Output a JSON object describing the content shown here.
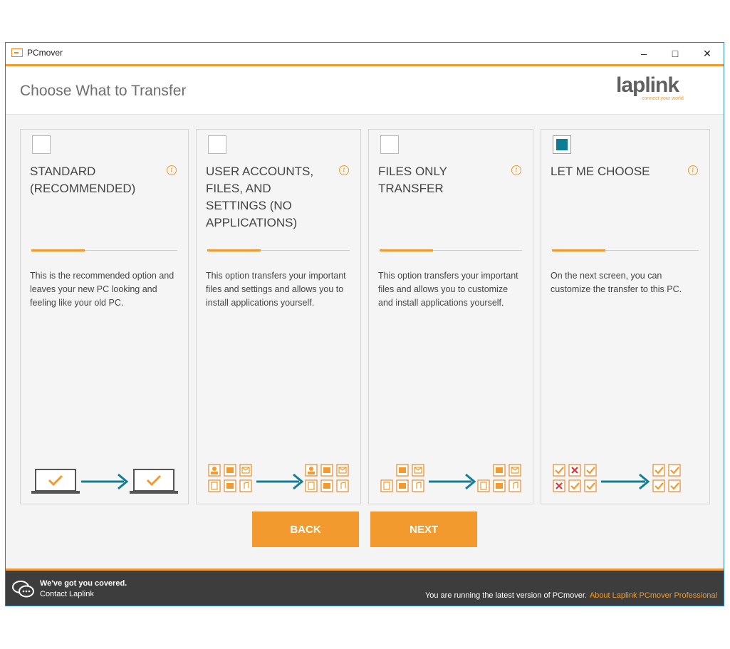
{
  "window": {
    "title": "PCmover",
    "minimize_glyph": "–",
    "maximize_glyph": "□",
    "close_glyph": "✕"
  },
  "header": {
    "title": "Choose What to Transfer",
    "logo_word": "laplink",
    "logo_tagline": "connect your world"
  },
  "cards": [
    {
      "title": "STANDARD (RECOMMENDED)",
      "checked": false,
      "info_glyph": "i",
      "description": "This is the recommended option and leaves your new PC looking and feeling like your old PC.",
      "illustration": "laptop-to-laptop"
    },
    {
      "title": "USER ACCOUNTS, FILES, AND SETTINGS (NO APPLICATIONS)",
      "checked": false,
      "info_glyph": "i",
      "description": "This option transfers your important files and settings and allows you to install applications yourself.",
      "illustration": "accounts-files-settings"
    },
    {
      "title": "FILES ONLY TRANSFER",
      "checked": false,
      "info_glyph": "i",
      "description": "This option transfers your important files and allows you to customize and install applications yourself.",
      "illustration": "files-only"
    },
    {
      "title": "LET ME CHOOSE",
      "checked": true,
      "info_glyph": "i",
      "description": "On the next screen, you can customize the transfer to this PC.",
      "illustration": "custom-checklist"
    }
  ],
  "buttons": {
    "back": "BACK",
    "next": "NEXT"
  },
  "footer": {
    "covered": "We've got you covered.",
    "contact": "Contact Laplink",
    "status": "You are running the latest version of PCmover.",
    "about": "About Laplink PCmover Professional"
  },
  "colors": {
    "accent": "#f29a2e",
    "teal": "#0f7c95",
    "footer_bg": "#3d3d3d",
    "error": "#d9363e"
  },
  "icons": [
    "app-icon",
    "info-icon",
    "chat-bubbles-icon",
    "laptop-icon",
    "arrow-right-icon",
    "user-icon",
    "folder-icon",
    "mail-icon",
    "document-icon",
    "camera-icon",
    "music-icon",
    "check-icon",
    "cross-icon"
  ]
}
